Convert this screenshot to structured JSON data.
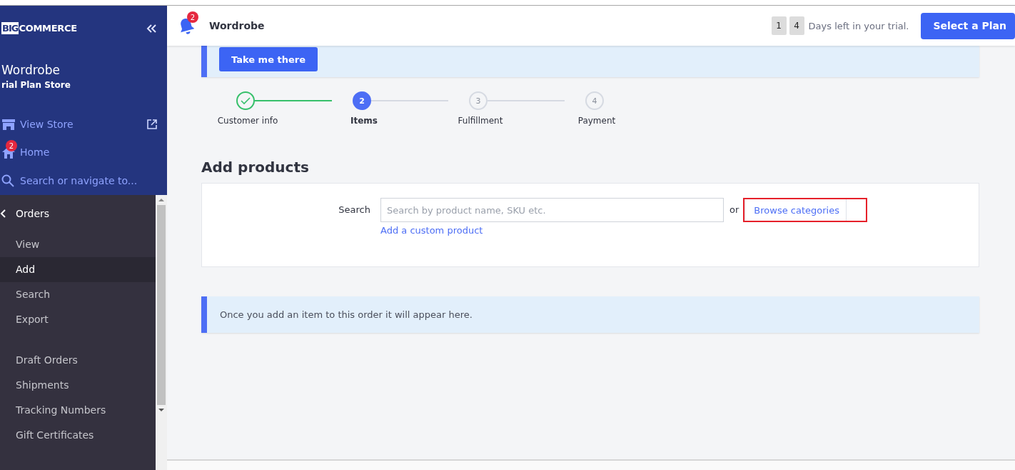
{
  "sidebar": {
    "logo": {
      "mark": "BIG",
      "word": "COMMERCE"
    },
    "store": {
      "name": "Wordrobe",
      "plan": "rial Plan Store"
    },
    "links": [
      {
        "kind": "store",
        "label": "View Store"
      },
      {
        "kind": "home",
        "label": "Home",
        "badge": "2"
      },
      {
        "kind": "search",
        "label": "Search or navigate to..."
      }
    ],
    "section": {
      "title": "Orders",
      "groups": [
        [
          {
            "label": "View",
            "selected": false
          },
          {
            "label": "Add",
            "selected": true
          },
          {
            "label": "Search",
            "selected": false
          },
          {
            "label": "Export",
            "selected": false
          }
        ],
        [
          {
            "label": "Draft Orders",
            "selected": false
          },
          {
            "label": "Shipments",
            "selected": false
          },
          {
            "label": "Tracking Numbers",
            "selected": false
          },
          {
            "label": "Gift Certificates",
            "selected": false
          }
        ]
      ]
    }
  },
  "header": {
    "notification_count": "2",
    "store_name": "Wordrobe",
    "trial_days": [
      "1",
      "4"
    ],
    "trial_text": "Days left in your trial.",
    "plan_button": "Select a Plan"
  },
  "banner": {
    "button": "Take me there"
  },
  "steps": [
    {
      "label": "Customer info",
      "completed": true,
      "selected": false
    },
    {
      "number": "2",
      "label": "Items",
      "completed": false,
      "selected": true
    },
    {
      "number": "3",
      "label": "Fulfillment",
      "completed": false,
      "selected": false
    },
    {
      "number": "4",
      "label": "Payment",
      "completed": false,
      "selected": false
    }
  ],
  "add_products": {
    "title": "Add products",
    "search_label": "Search",
    "placeholder": "Search by product name, SKU etc.",
    "or": "or",
    "browse_button": "Browse categories",
    "browse_highlighted": true,
    "custom_link": "Add a custom product"
  },
  "info_message": "Once you add an item to this order it will appear here."
}
